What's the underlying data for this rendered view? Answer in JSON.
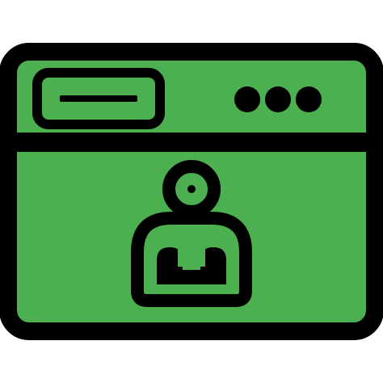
{
  "icon": {
    "name": "browser-user-profile-icon",
    "colors": {
      "outline": "#000000",
      "fill": "#4caf50",
      "background": "#ffffff"
    },
    "window_dots_count": 3
  }
}
